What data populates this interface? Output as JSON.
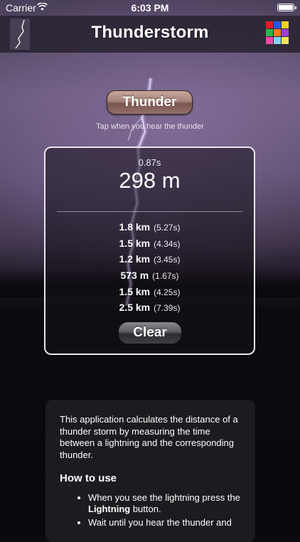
{
  "status_bar": {
    "carrier": "Carrier",
    "time": "6:03 PM",
    "battery_level": 1.0
  },
  "nav": {
    "title": "Thunderstorm",
    "palette_colors": [
      "#e21c2c",
      "#2a56e6",
      "#f3d21d",
      "#2fb34a",
      "#ff7a1a",
      "#9b3fd9",
      "#f04aa6",
      "#7fd5f2",
      "#f7e55a"
    ]
  },
  "thunder_button": {
    "label": "Thunder"
  },
  "hint": "Tap when you hear the thunder",
  "latest": {
    "time": "0.87s",
    "distance": "298 m"
  },
  "history": [
    {
      "distance": "1.8 km",
      "time": "(5.27s)"
    },
    {
      "distance": "1.5 km",
      "time": "(4.34s)"
    },
    {
      "distance": "1.2 km",
      "time": "(3.45s)"
    },
    {
      "distance": "573 m",
      "time": "(1.67s)"
    },
    {
      "distance": "1.5 km",
      "time": "(4.25s)"
    },
    {
      "distance": "2.5 km",
      "time": "(7.39s)"
    }
  ],
  "clear_button": {
    "label": "Clear"
  },
  "info": {
    "intro": "This application calculates the distance of a thunder storm by measuring the time between a lightning and the corresponding thunder.",
    "heading": "How to use",
    "step1_prefix": "When you see the lightning press the ",
    "step1_bold": "Lightning",
    "step1_suffix": " button.",
    "step2": "Wait until you hear the thunder and"
  }
}
